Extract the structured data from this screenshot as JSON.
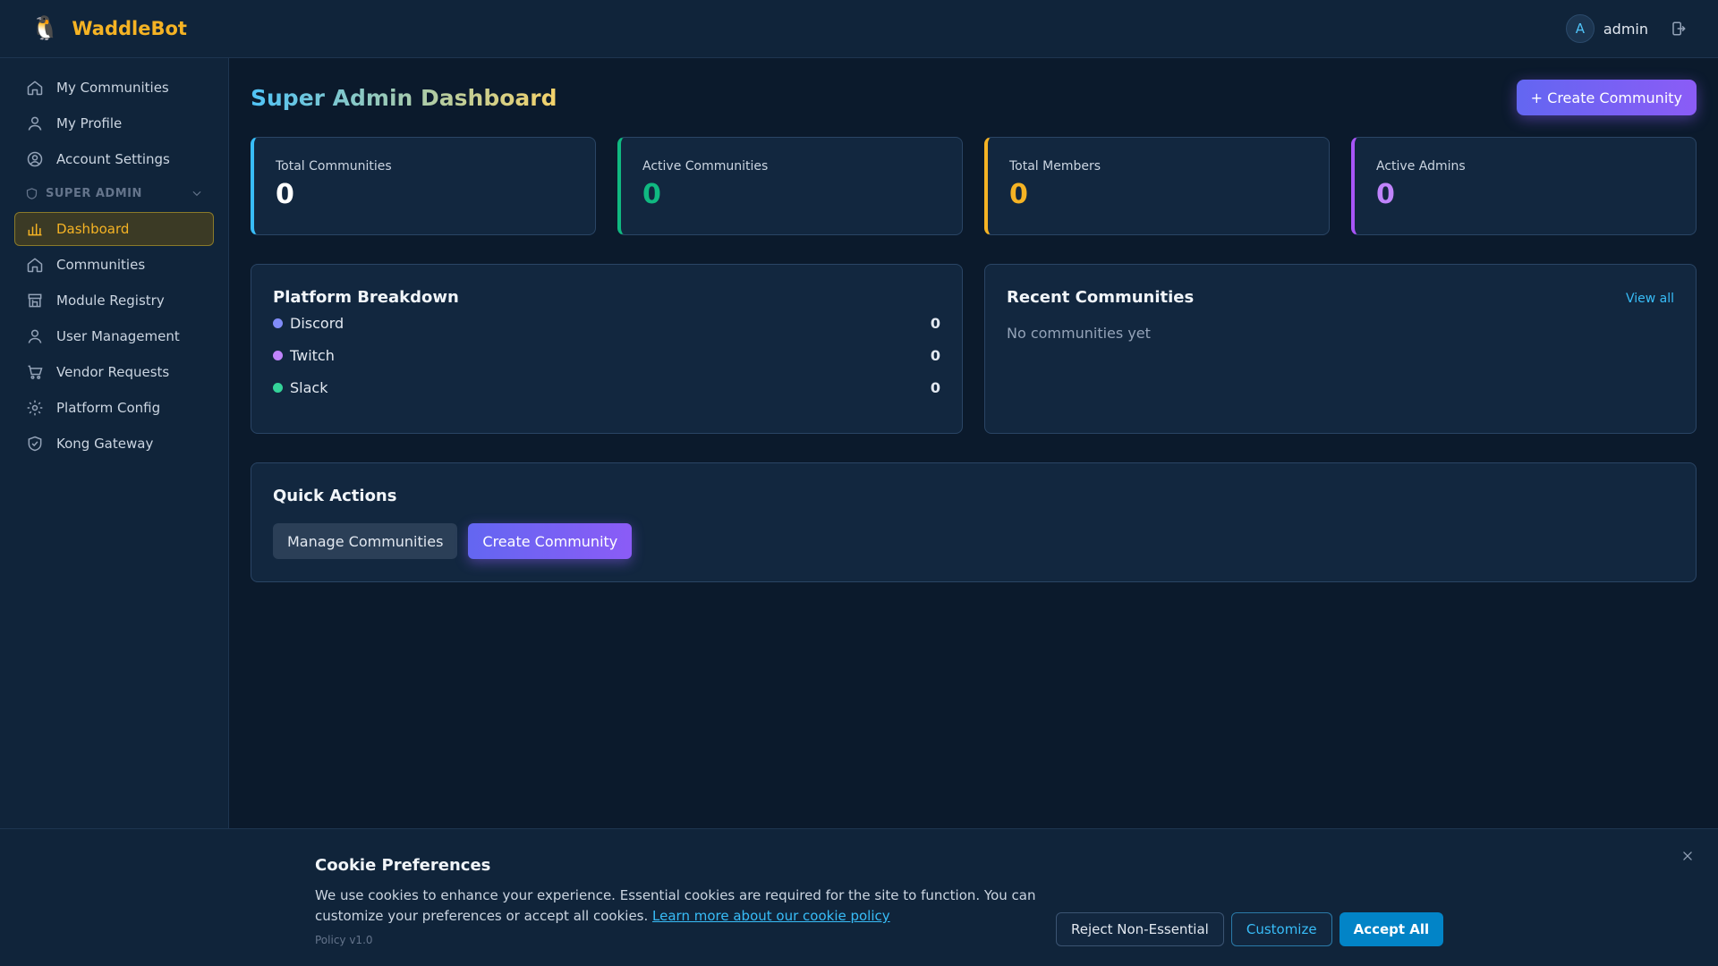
{
  "app": {
    "logo_glyph": "🐧",
    "name": "WaddleBot"
  },
  "user": {
    "avatar_initial": "A",
    "name": "admin"
  },
  "sidebar": {
    "items": [
      {
        "label": "My Communities",
        "icon": "home-icon"
      },
      {
        "label": "My Profile",
        "icon": "user-icon"
      },
      {
        "label": "Account Settings",
        "icon": "user-circle-icon"
      }
    ],
    "section": {
      "label": "SUPER ADMIN",
      "icon": "shield-icon",
      "collapse_icon": "chevron-down-icon"
    },
    "admin_items": [
      {
        "label": "Dashboard",
        "icon": "bar-chart-icon",
        "active": true
      },
      {
        "label": "Communities",
        "icon": "home-icon"
      },
      {
        "label": "Module Registry",
        "icon": "storefront-icon"
      },
      {
        "label": "User Management",
        "icon": "user-icon"
      },
      {
        "label": "Vendor Requests",
        "icon": "cart-icon"
      },
      {
        "label": "Platform Config",
        "icon": "gear-icon"
      },
      {
        "label": "Kong Gateway",
        "icon": "shield-check-icon"
      }
    ]
  },
  "page": {
    "title": "Super Admin Dashboard",
    "create_button": "+ Create Community"
  },
  "stats": [
    {
      "label": "Total Communities",
      "value": "0",
      "color": "#38bdf8"
    },
    {
      "label": "Active Communities",
      "value": "0",
      "color": "#10b981"
    },
    {
      "label": "Total Members",
      "value": "0",
      "color": "#f5b324"
    },
    {
      "label": "Active Admins",
      "value": "0",
      "color": "#a855f7"
    }
  ],
  "breakdown": {
    "title": "Platform Breakdown",
    "platforms": [
      {
        "name": "Discord",
        "count": "0",
        "color": "#818cf8"
      },
      {
        "name": "Twitch",
        "count": "0",
        "color": "#c084fc"
      },
      {
        "name": "Slack",
        "count": "0",
        "color": "#34d399"
      }
    ]
  },
  "recent": {
    "title": "Recent Communities",
    "view_all": "View all",
    "empty": "No communities yet"
  },
  "quick_actions": {
    "title": "Quick Actions",
    "manage": "Manage Communities",
    "create": "Create Community"
  },
  "cookie": {
    "title": "Cookie Preferences",
    "text": "We use cookies to enhance your experience. Essential cookies are required for the site to function. You can customize your preferences or accept all cookies.",
    "link": "Learn more about our cookie policy",
    "version": "Policy v1.0",
    "reject": "Reject Non-Essential",
    "customize": "Customize",
    "accept": "Accept All"
  }
}
